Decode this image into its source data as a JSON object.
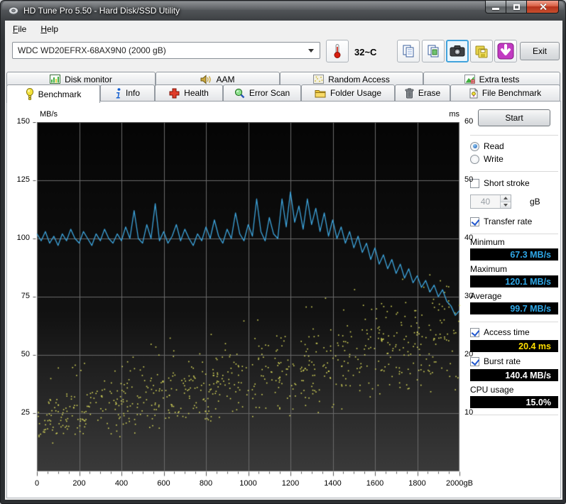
{
  "window": {
    "title": "HD Tune Pro 5.50 - Hard Disk/SSD Utility"
  },
  "menu": {
    "items": [
      {
        "accel": "F",
        "rest": "ile"
      },
      {
        "accel": "H",
        "rest": "elp"
      }
    ]
  },
  "toolbar": {
    "drive_selected": "WDC WD20EFRX-68AX9N0 (2000 gB)",
    "temperature": "32~C",
    "exit_label": "Exit",
    "icon_buttons": [
      "thermometer",
      "copy-text",
      "copy-image",
      "screenshot-camera",
      "save",
      "download"
    ]
  },
  "tabs_top": [
    {
      "label": "Disk monitor"
    },
    {
      "label": "AAM"
    },
    {
      "label": "Random Access"
    },
    {
      "label": "Extra tests"
    }
  ],
  "tabs_main": [
    {
      "label": "Benchmark",
      "active": true
    },
    {
      "label": "Info"
    },
    {
      "label": "Health"
    },
    {
      "label": "Error Scan"
    },
    {
      "label": "Folder Usage"
    },
    {
      "label": "Erase"
    },
    {
      "label": "File Benchmark"
    }
  ],
  "controls": {
    "start": "Start",
    "read": "Read",
    "write": "Write",
    "short_stroke": "Short stroke",
    "short_stroke_value": "40",
    "short_stroke_unit": "gB",
    "transfer_rate": "Transfer rate",
    "minimum_label": "Minimum",
    "minimum": "67.3 MB/s",
    "maximum_label": "Maximum",
    "maximum": "120.1 MB/s",
    "average_label": "Average",
    "average": "99.7 MB/s",
    "access_time_label": "Access time",
    "access_time": "20.4 ms",
    "burst_rate_label": "Burst rate",
    "burst_rate": "140.4 MB/s",
    "cpu_label": "CPU usage",
    "cpu": "15.0%"
  },
  "colors": {
    "value_bg": "#000000",
    "value_cyan": "#2fa8e8",
    "value_yellow": "#ffdf00",
    "value_white": "#ffffff"
  },
  "chart_data": {
    "type": "line+scatter",
    "x_axis": {
      "range": [
        0,
        2000
      ],
      "unit": "gB",
      "tick_labels": [
        "0",
        "200",
        "400",
        "600",
        "800",
        "1000",
        "1200",
        "1400",
        "1600",
        "1800",
        "2000gB"
      ],
      "minor_tick_step": 50
    },
    "y_left_axis": {
      "label": "MB/s",
      "range": [
        0,
        150
      ],
      "tick_labels": [
        "150",
        "125",
        "100",
        "75",
        "50",
        "25"
      ]
    },
    "y_right_axis": {
      "label": "ms",
      "range": [
        0,
        60
      ],
      "tick_labels": [
        "60",
        "50",
        "40",
        "30",
        "20",
        "10"
      ]
    },
    "grid": {
      "color": "#6a6a6a",
      "x_interval_gB": 200,
      "y_interval_MBps": 25
    },
    "plot_bg_top": "#050505",
    "plot_bg_bottom": "#3a3a3a",
    "series": [
      {
        "name": "Transfer rate",
        "type": "line",
        "axis": "left",
        "color": "#3da4dc",
        "x_step_gB": 20,
        "values_MBps": [
          102,
          99,
          103,
          98,
          101,
          97,
          102,
          99,
          104,
          100,
          98,
          103,
          100,
          97,
          102,
          99,
          104,
          100,
          98,
          102,
          99,
          105,
          100,
          112,
          100,
          98,
          106,
          100,
          115,
          99,
          103,
          98,
          101,
          106,
          99,
          104,
          100,
          97,
          102,
          99,
          105,
          100,
          108,
          101,
          98,
          104,
          100,
          111,
          102,
          99,
          106,
          101,
          117,
          103,
          99,
          109,
          102,
          100,
          117,
          105,
          120,
          107,
          114,
          104,
          117,
          106,
          113,
          103,
          111,
          101,
          108,
          100,
          105,
          98,
          103,
          96,
          101,
          94,
          98,
          91,
          96,
          89,
          93,
          87,
          91,
          85,
          89,
          83,
          87,
          81,
          84,
          79,
          82,
          77,
          80,
          75,
          78,
          73,
          71,
          67,
          69
        ]
      },
      {
        "name": "Access time",
        "type": "scatter",
        "axis": "right",
        "color": "#d8d85a",
        "point_count": 720,
        "seed": 20,
        "band_ms_min_start_end": [
          4,
          13
        ],
        "band_ms_max_start_end": [
          14,
          34
        ]
      }
    ],
    "stats": {
      "minimum_MBps": 67.3,
      "maximum_MBps": 120.1,
      "average_MBps": 99.7,
      "access_time_ms": 20.4,
      "burst_rate_MBps": 140.4,
      "cpu_usage_pct": 15.0
    }
  }
}
